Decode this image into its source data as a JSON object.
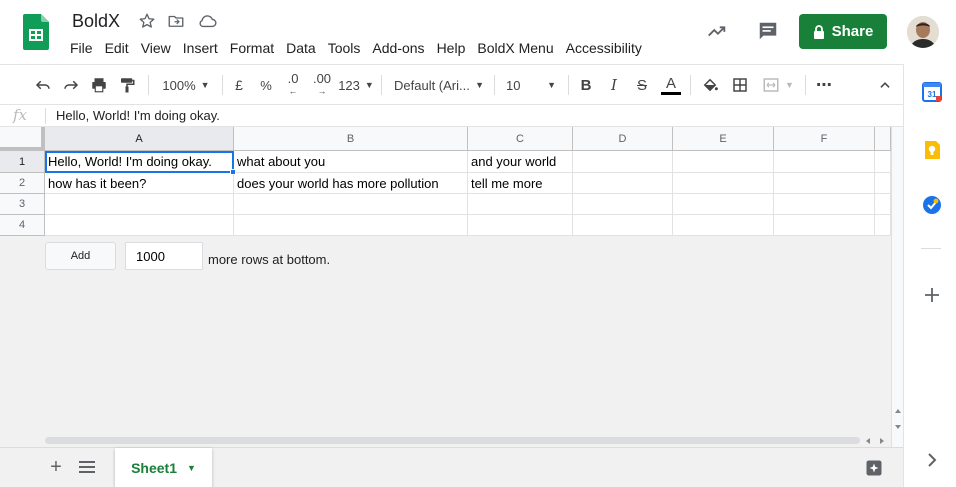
{
  "header": {
    "doc_title": "BoldX",
    "menu": [
      "File",
      "Edit",
      "View",
      "Insert",
      "Format",
      "Data",
      "Tools",
      "Add-ons",
      "Help",
      "BoldX Menu",
      "Accessibility"
    ],
    "share_label": "Share",
    "brand_color": "#188038"
  },
  "toolbar": {
    "zoom": "100%",
    "currency": "£",
    "percent": "%",
    "dec_decrease": ".0",
    "dec_increase": ".00",
    "number_format": "123",
    "font": "Default (Ari...",
    "font_size": "10",
    "bold": "B",
    "italic": "I",
    "strike": "S",
    "text_color": "A",
    "more": "⋯"
  },
  "formula_bar": {
    "fx": "fx",
    "value": "Hello, World! I'm doing okay."
  },
  "grid": {
    "columns": [
      "A",
      "B",
      "C",
      "D",
      "E",
      "F"
    ],
    "rows": [
      "1",
      "2",
      "3",
      "4"
    ],
    "cells": [
      [
        "Hello, World! I'm doing okay.",
        "what about you",
        "and your world",
        "",
        "",
        ""
      ],
      [
        "how has it been?",
        "does your world has more pollution",
        "tell me more",
        "",
        "",
        ""
      ],
      [
        "",
        "",
        "",
        "",
        "",
        ""
      ],
      [
        "",
        "",
        "",
        "",
        "",
        ""
      ]
    ],
    "active_cell": "A1",
    "add_label": "Add",
    "add_rows_value": "1000",
    "add_rows_suffix": "more rows at bottom."
  },
  "sheets": {
    "tabs": [
      "Sheet1"
    ],
    "active": "Sheet1"
  }
}
